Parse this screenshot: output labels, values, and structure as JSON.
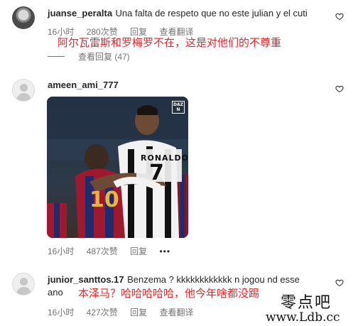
{
  "comments": [
    {
      "username": "juanse_peralta",
      "text": "Una falta de respeto que no este julian y el cuti",
      "time": "16小时",
      "likes": "280次赞",
      "reply": "回复",
      "translate": "查看翻译",
      "overlay_text": "阿尔瓦雷斯和罗梅罗不在，这是对他们的不尊重",
      "view_replies": "查看回复 (47)"
    },
    {
      "username": "ameen_ami_777",
      "image_label": "DAZN",
      "jersey_name": "RONALDO",
      "jersey_number_white": "7",
      "jersey_number_yellow": "10",
      "time": "16小时",
      "likes": "487次赞",
      "reply": "回复",
      "more": "•••"
    },
    {
      "username": "junior_santtos.17",
      "text_line1": "Benzema ? kkkkkkkkkkkk n jogou nd esse",
      "text_line2": "ano",
      "overlay_text": "本泽马？哈哈哈哈哈，他今年啥都没踢",
      "time": "16小时",
      "likes": "427次赞",
      "reply": "回复",
      "translate": "查看翻译"
    }
  ],
  "watermark": {
    "title": "零点吧",
    "url": "www.Ldb.cc"
  },
  "colors": {
    "overlay_red": "#e8262a",
    "meta_gray": "#737373",
    "text_dark": "#262626"
  },
  "icons": [
    "heart-icon",
    "default-avatar-icon",
    "more-icon"
  ]
}
